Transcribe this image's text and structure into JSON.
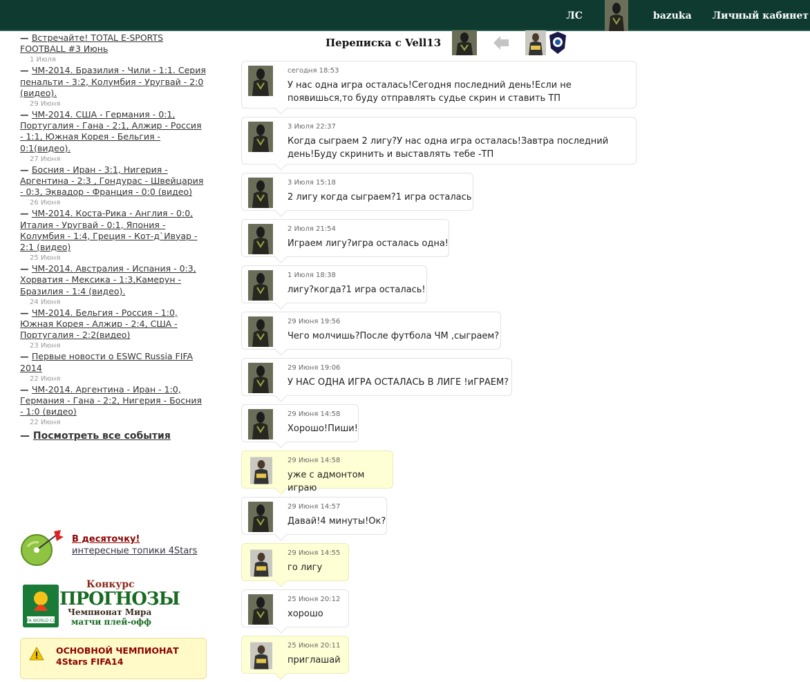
{
  "header": {
    "ls_label": "ЛС",
    "username": "bazuka",
    "cabinet_label": "Личный кабинет"
  },
  "sidebar": {
    "events": [
      {
        "title": "Встречайте! TOTAL E-SPORTS FOOTBALL #3 Июнь",
        "date": "1 Июля"
      },
      {
        "title": "ЧМ-2014. Бразилия - Чили - 1:1. Серия пенальти - 3:2, Колумбия - Уругвай - 2:0 (видео).",
        "date": "29 Июня"
      },
      {
        "title": "ЧМ-2014. США - Германия - 0:1, Португалия - Гана - 2:1, Алжир - Россия - 1:1, Южная Корея - Бельгия - 0:1(видео).",
        "date": "27 Июня"
      },
      {
        "title": "Босния - Иран - 3:1, Нигерия - Аргентина - 2:3 , Гондурас - Швейцария - 0:3, Эквадор - Франция - 0:0 (видео)",
        "date": "26 Июня"
      },
      {
        "title": "ЧМ-2014. Коста-Рика - Англия - 0:0, Италия - Уругвай - 0:1, Япония - Колумбия - 1:4, Греция - Кот-д`Ивуар - 2:1 (видео)",
        "date": "25 Июня"
      },
      {
        "title": "ЧМ-2014. Австралия - Испания - 0:3, Хорватия - Мексика - 1:3,Камерун - Бразилия - 1:4 (видео).",
        "date": "24 Июня"
      },
      {
        "title": "ЧМ-2014. Бельгия - Россия - 1:0, Южная Корея - Алжир - 2:4, США - Португалия - 2:2(видео)",
        "date": "23 Июня"
      },
      {
        "title": "Первые новости о ESWC Russia FIFA 2014",
        "date": "22 Июня"
      },
      {
        "title": "ЧМ-2014. Аргентина - Иран - 1:0, Германия - Гана - 2:2, Нигерия - Босния - 1:0 (видео)",
        "date": "22 Июня"
      }
    ],
    "see_all": "Посмотреть все события",
    "promo_title": "В десяточку!",
    "promo_sub": "интересные топики 4Stars",
    "contest_kon": "Конкурс",
    "contest_prog": "ПРОГНОЗЫ",
    "contest_champ": "Чемпионат Мира",
    "contest_matchi": "матчи плей-офф",
    "alert_line1": "ОСНОВНОЙ ЧЕМПИОНАТ",
    "alert_line2": "4Stars FIFA14"
  },
  "conversation": {
    "title": "Переписка с Vell13",
    "messages": [
      {
        "from": "other",
        "time": "сегодня 18:53",
        "lines": [
          "У нас одна игра осталась!Сегодня последний день!Если не",
          "появишься,то буду отправлять судье скрин и ставить ТП"
        ]
      },
      {
        "from": "other",
        "time": "3 Июля 22:37",
        "lines": [
          "Когда сыграем 2 лигу?У нас одна игра осталась!Завтра последний",
          "день!Буду скринить и выставлять тебе -ТП"
        ]
      },
      {
        "from": "other",
        "time": "3 Июля 15:18",
        "lines": [
          "2 лигу когда сыграем?1 игра осталась"
        ]
      },
      {
        "from": "other",
        "time": "2 Июля 21:54",
        "lines": [
          "Играем лигу?игра осталась одна!"
        ]
      },
      {
        "from": "other",
        "time": "1 Июля 18:38",
        "lines": [
          "лигу?когда?1 игра осталась!"
        ]
      },
      {
        "from": "other",
        "time": "29 Июня 19:56",
        "lines": [
          "Чего молчишь?После футбола ЧМ ,сыграем?"
        ]
      },
      {
        "from": "other",
        "time": "29 Июня 19:06",
        "lines": [
          "У НАС ОДНА ИГРА ОСТАЛАСЬ В ЛИГЕ !иГРАЕМ?"
        ]
      },
      {
        "from": "other",
        "time": "29 Июня 14:58",
        "lines": [
          "Хорошо!Пиши!"
        ]
      },
      {
        "from": "me",
        "time": "29 Июня 14:58",
        "lines": [
          "уже с адмонтом играю"
        ]
      },
      {
        "from": "other",
        "time": "29 Июня 14:57",
        "lines": [
          "Давай!4 минуты!Ок?"
        ]
      },
      {
        "from": "me",
        "time": "29 Июня 14:55",
        "lines": [
          "го лигу"
        ]
      },
      {
        "from": "other",
        "time": "25 Июня 20:12",
        "lines": [
          "хорошо"
        ]
      },
      {
        "from": "me",
        "time": "25 Июня 20:11",
        "lines": [
          "приглашай"
        ]
      }
    ]
  },
  "colors": {
    "topbar": "#0e3a30",
    "my_bubble": "#ffffd6",
    "alert_bg": "#fffac8",
    "alert_text": "#8b0000"
  }
}
